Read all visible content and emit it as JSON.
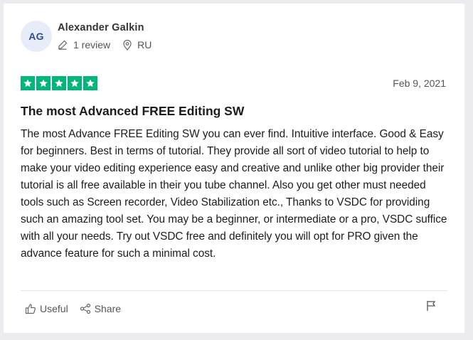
{
  "review": {
    "author": {
      "initials": "AG",
      "name": "Alexander Galkin",
      "review_count": "1 review",
      "country": "RU"
    },
    "rating": 5,
    "date": "Feb 9, 2021",
    "title": "The most Advanced FREE Editing SW",
    "body": "The most Advance FREE Editing SW you can ever find. Intuitive interface. Good & Easy for beginners. Best in terms of tutorial. They provide all sort of video tutorial to help to make your video editing experience easy and creative and unlike other big provider their tutorial is all free available in their you tube channel. Also you get other must needed tools such as Screen recorder, Video Stabilization etc., Thanks to VSDC for providing such an amazing tool set. You may be a beginner, or intermediate or a pro, VSDC suffice with all your needs. Try out VSDC free and definitely you will opt for PRO given the advance feature for such a minimal cost."
  },
  "actions": {
    "useful_label": "Useful",
    "share_label": "Share"
  },
  "colors": {
    "star_green": "#00b67a",
    "avatar_bg": "#e6edf9",
    "avatar_text": "#2e4f8f"
  },
  "icons": [
    "pencil-icon",
    "location-pin-icon",
    "star-icon",
    "thumbs-up-icon",
    "share-icon",
    "flag-icon"
  ]
}
